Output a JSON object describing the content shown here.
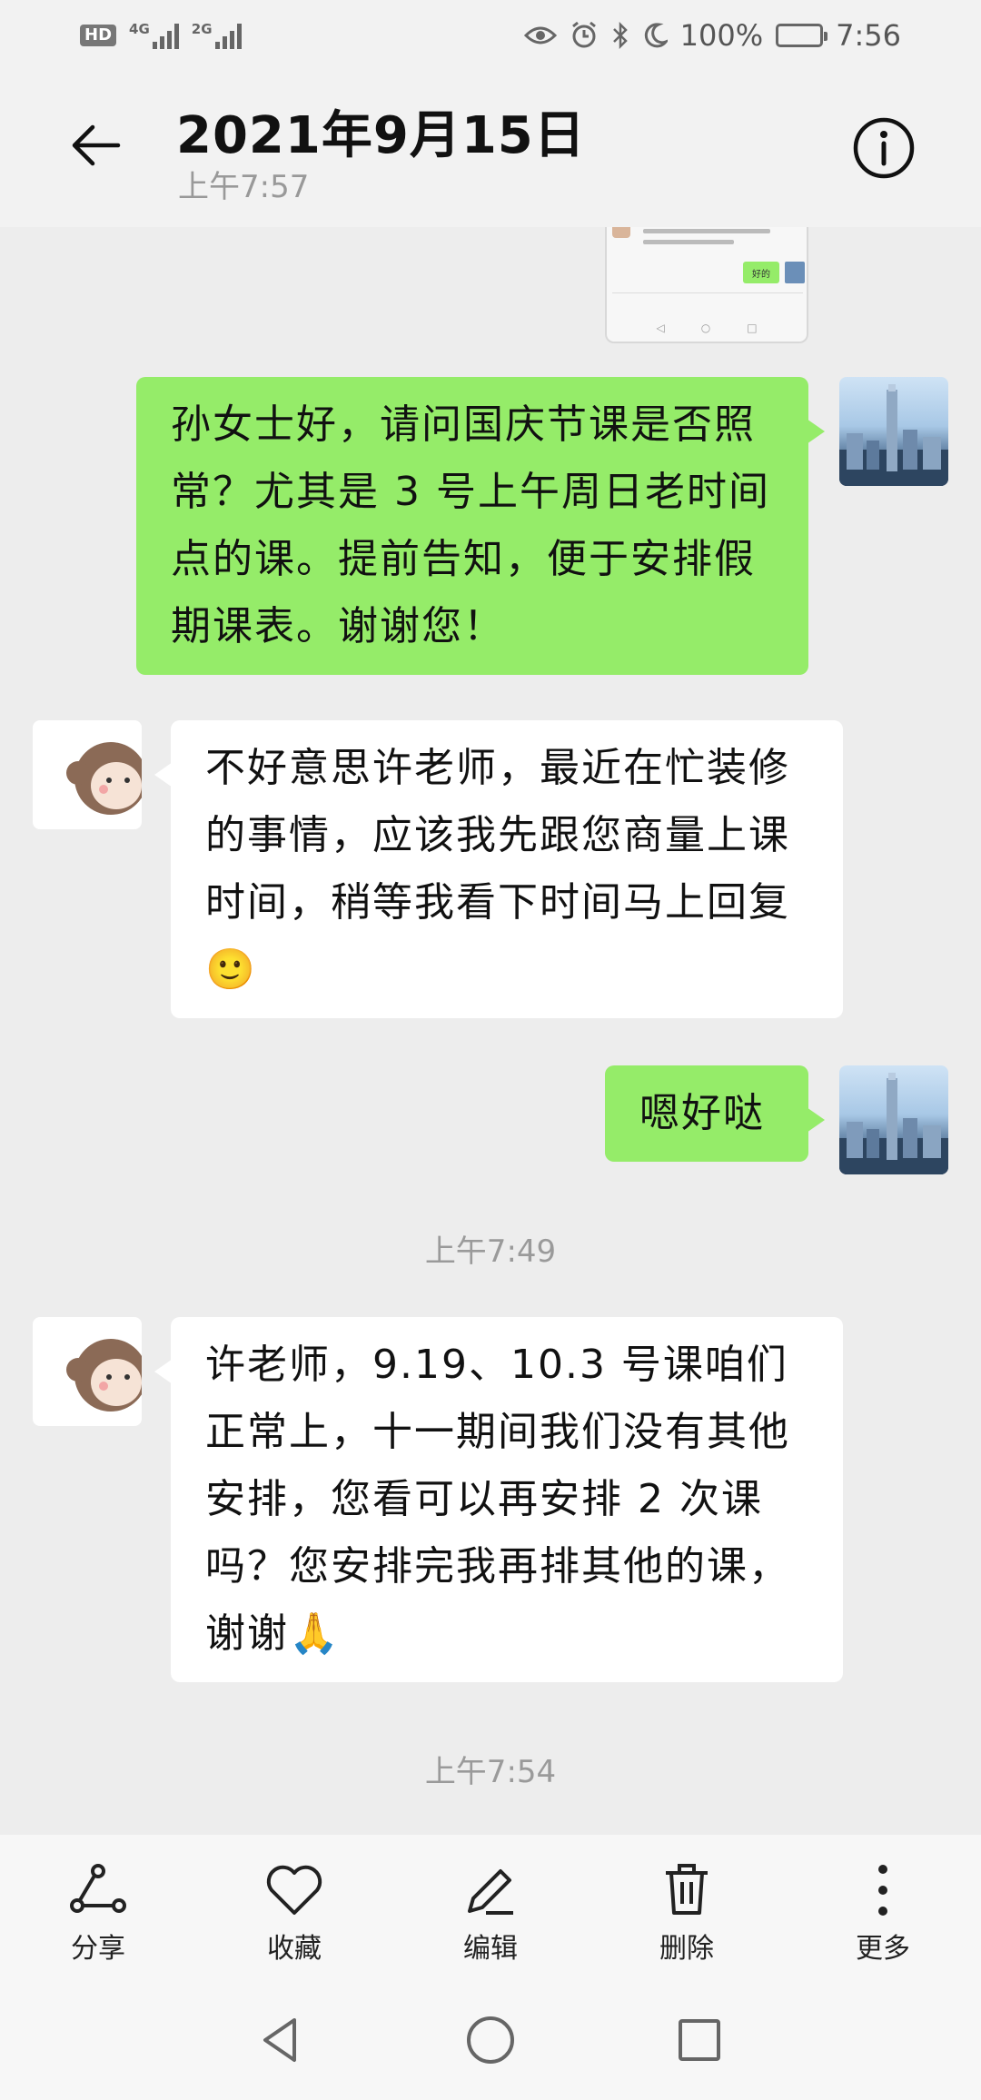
{
  "status_bar": {
    "hd": "HD",
    "net1": "4G",
    "net2": "2G",
    "battery": "100%",
    "time": "7:56"
  },
  "header": {
    "title": "2021年9月15日",
    "subtitle": "上午7:57"
  },
  "screenshot_thumbnail": {
    "reply_label": "好的"
  },
  "messages": [
    {
      "sender": "me",
      "text": "孙女士好，请问国庆节课是否照常？尤其是 3 号上午周日老时间点的课。提前告知，便于安排假期课表。谢谢您！"
    },
    {
      "sender": "other",
      "text": "不好意思许老师，最近在忙装修的事情，应该我先跟您商量上课时间，稍等我看下时间马上回复🙂"
    },
    {
      "sender": "me",
      "text": "嗯好哒"
    },
    {
      "sender": "other",
      "text": "许老师，9.19、10.3 号课咱们正常上，十一期间我们没有其他安排，您看可以再安排 2 次课吗？您安排完我再排其他的课，谢谢🙏"
    }
  ],
  "timestamps": [
    "上午7:49",
    "上午7:54"
  ],
  "toolbar": {
    "share": "分享",
    "favorite": "收藏",
    "edit": "编辑",
    "delete": "删除",
    "more": "更多"
  },
  "colors": {
    "my_bubble": "#95ec69",
    "other_bubble": "#ffffff",
    "background": "#ededed"
  }
}
